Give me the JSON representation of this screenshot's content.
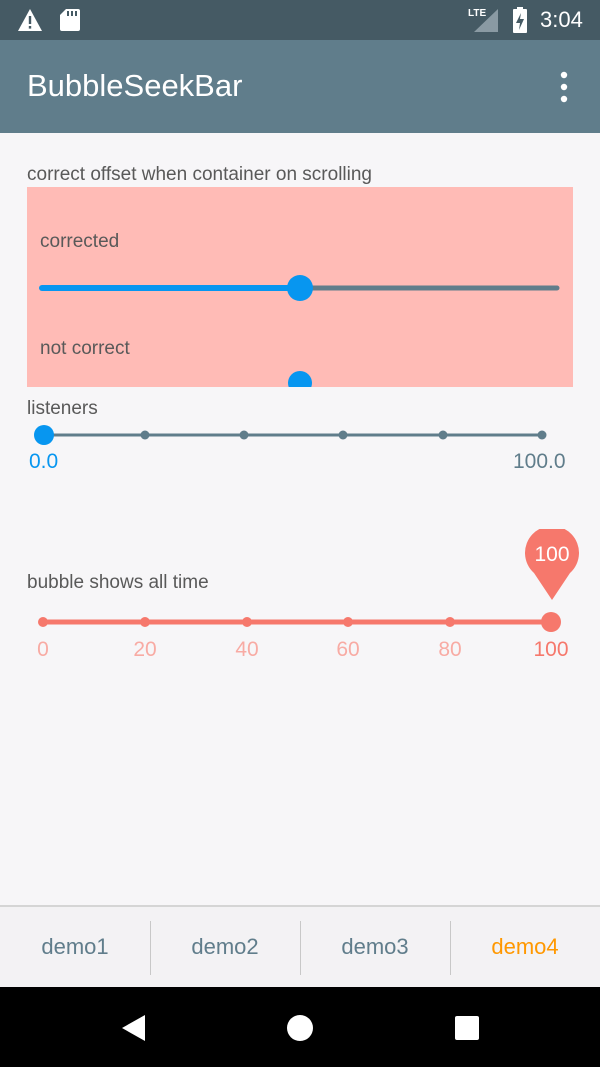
{
  "status_bar": {
    "time": "3:04",
    "network": "LTE",
    "icons": [
      "warning-icon",
      "sd-card-icon",
      "signal-icon",
      "battery-icon"
    ]
  },
  "app_bar": {
    "title": "BubbleSeekBar",
    "menu_icon": "overflow-menu-icon"
  },
  "sections": {
    "scroll_container": {
      "heading": "correct offset when container on scrolling",
      "corrected_label": "corrected",
      "not_correct_label": "not correct",
      "corrected_progress": 0.5,
      "not_correct_progress": 0.5,
      "background_color": "#ffbbb6"
    },
    "listeners": {
      "label": "listeners",
      "min_text": "0.0",
      "max_text": "100.0",
      "progress": 0,
      "section_count": 5
    },
    "bubble_all_time": {
      "label": "bubble shows all time",
      "bubble_text": "100",
      "progress": 1,
      "ticks": [
        "0",
        "20",
        "40",
        "60",
        "80",
        "100"
      ],
      "color": "#f6786c"
    }
  },
  "tabs": [
    {
      "label": "demo1",
      "selected": false
    },
    {
      "label": "demo2",
      "selected": false
    },
    {
      "label": "demo3",
      "selected": false
    },
    {
      "label": "demo4",
      "selected": true
    }
  ],
  "colors": {
    "primary": "#607d8b",
    "primary_dark": "#455a64",
    "accent": "#ff9800",
    "seek_blue": "#0796f0"
  },
  "nav_bar": {
    "icons": [
      "back-icon",
      "home-icon",
      "recents-icon"
    ]
  }
}
